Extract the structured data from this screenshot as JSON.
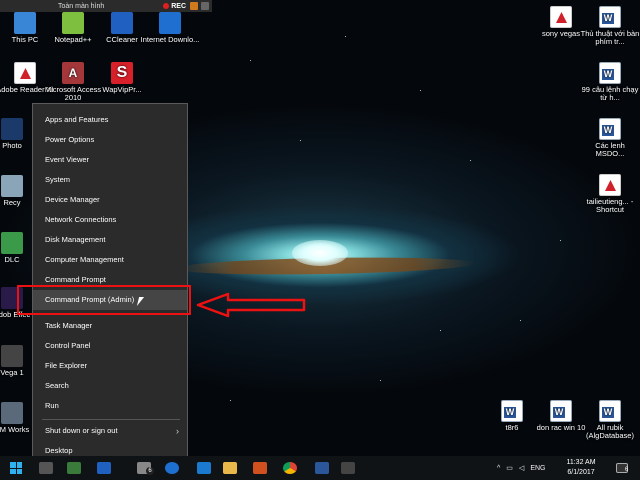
{
  "recording_bar": {
    "title": "Toàn màn hình",
    "rec_label": "REC"
  },
  "desktop_icons_left": [
    {
      "label": "This PC",
      "icon": "computer-icon"
    },
    {
      "label": "Notepad++",
      "icon": "notepad-icon"
    },
    {
      "label": "CCleaner",
      "icon": "ccleaner-icon"
    },
    {
      "label": "Internet Downlo...",
      "icon": "internet-download-icon"
    },
    {
      "label": "Adobe Reader XI",
      "icon": "adobe-reader-icon"
    },
    {
      "label": "Microsoft Access 2010",
      "icon": "access-icon",
      "glyph": "A"
    },
    {
      "label": "WapVipPr...",
      "icon": "wapvip-icon",
      "glyph": "S"
    },
    {
      "label": "Photo",
      "icon": "photoshop-icon"
    },
    {
      "label": "Recy",
      "icon": "recycle-bin-icon"
    },
    {
      "label": "DLC",
      "icon": "dlc-icon"
    },
    {
      "label": "Adob Effec",
      "icon": "after-effects-icon"
    },
    {
      "label": "Vega 1",
      "icon": "vegas-icon"
    },
    {
      "label": "VM Works",
      "icon": "vmware-icon"
    }
  ],
  "desktop_icons_right": [
    {
      "label": "sony vegas",
      "icon": "pdf-icon"
    },
    {
      "label": "Thủ thuật với bàn phím tr...",
      "icon": "word-doc-icon"
    },
    {
      "label": "99 câu lệnh chạy từ h...",
      "icon": "word-doc-icon"
    },
    {
      "label": "Các lenh MSDO...",
      "icon": "word-doc-icon"
    },
    {
      "label": "tailieutieng... - Shortcut",
      "icon": "pdf-icon"
    },
    {
      "label": "t8r6",
      "icon": "word-doc-icon"
    },
    {
      "label": "don rac win 10",
      "icon": "word-doc-icon"
    },
    {
      "label": "All rubik (AlgDatabase)",
      "icon": "word-doc-icon"
    }
  ],
  "context_menu": {
    "items": [
      "Apps and Features",
      "Power Options",
      "Event Viewer",
      "System",
      "Device Manager",
      "Network Connections",
      "Disk Management",
      "Computer Management",
      "Command Prompt",
      "Command Prompt (Admin)",
      "Task Manager",
      "Control Panel",
      "File Explorer",
      "Search",
      "Run",
      "Shut down or sign out",
      "Desktop"
    ],
    "highlighted": "Command Prompt (Admin)"
  },
  "taskbar": {
    "language": "ENG",
    "time": "11:32 AM",
    "date": "6/1/2017",
    "badge_count": "6",
    "notification_count": "6"
  },
  "colors": {
    "annotation_red": "#e11111",
    "menu_bg": "#2b2b2b",
    "taskbar_bg": "#101316"
  }
}
